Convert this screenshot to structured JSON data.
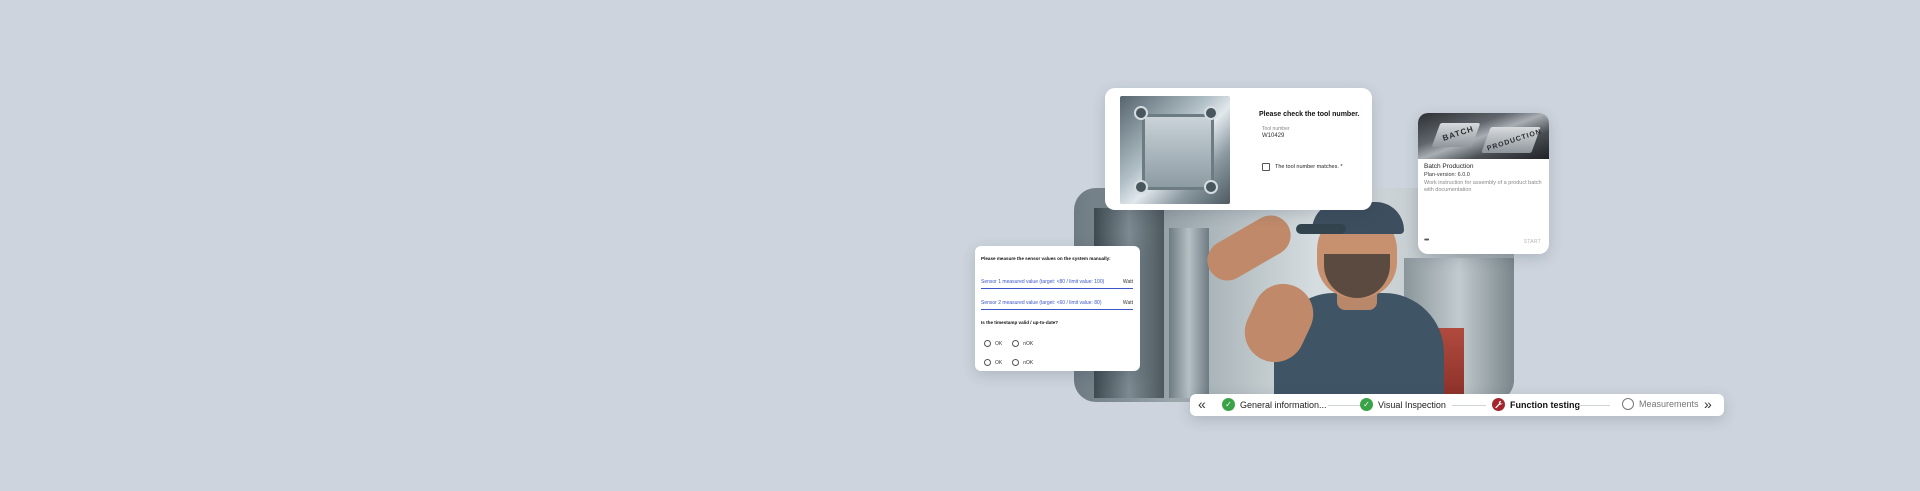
{
  "tool_check": {
    "title": "Please check the tool number.",
    "field_label": "Tool number",
    "field_value": "W10429",
    "checkbox_label": "The tool number matches. *"
  },
  "batch": {
    "image_text_1": "BATCH",
    "image_text_2": "PRODUCTION",
    "title": "Batch Production",
    "version": "Plan-version: 6.0.0",
    "description": "Work instruction for assembly of a product batch with documentation",
    "more": "•••",
    "start": "START"
  },
  "sensors": {
    "title": "Please measure the sensor values on the system manually:",
    "fields": [
      {
        "label": "Sensor 1 measured value (target: <80 / limit value: 100)",
        "unit": "Watt"
      },
      {
        "label": "Sensor 2 measured value (target: <60 / limit value: 80)",
        "unit": "Watt"
      }
    ],
    "timestamp_title": "Is the timestamp valid / up-to-date?",
    "radio_rows": [
      {
        "ok": "OK",
        "nok": "nOK"
      },
      {
        "ok": "OK",
        "nok": "nOK"
      }
    ]
  },
  "stepper": {
    "prev": "«",
    "next": "»",
    "steps": [
      {
        "label": "General information...",
        "status": "done"
      },
      {
        "label": "Visual Inspection",
        "status": "done"
      },
      {
        "label": "Function testing",
        "status": "active"
      },
      {
        "label": "Measurements",
        "status": "todo"
      }
    ],
    "icons": {
      "done": "check-icon",
      "active": "wrench-icon",
      "todo": "circle-icon"
    },
    "colors": {
      "done": "#3aa348",
      "active": "#a3262c"
    }
  }
}
